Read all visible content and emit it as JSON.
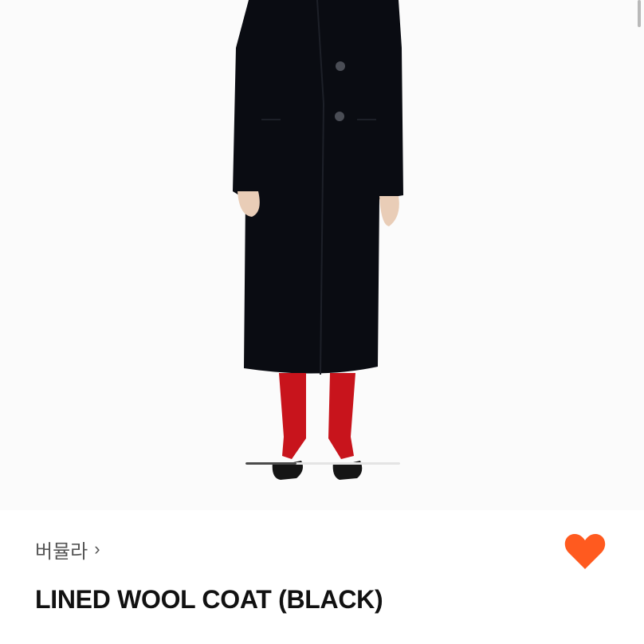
{
  "brand": {
    "name": "버뮬라",
    "chevron": "›"
  },
  "product": {
    "title": "LINED WOOL COAT (BLACK)"
  },
  "carousel": {
    "progress": 0.33
  },
  "favorite": {
    "icon": "heart-icon",
    "color": "#ff5a1f",
    "active": true
  },
  "colors": {
    "coat": "#0a0c12",
    "tights": "#c8141c",
    "shoes": "#151515",
    "skin": "#e9cdb7"
  }
}
